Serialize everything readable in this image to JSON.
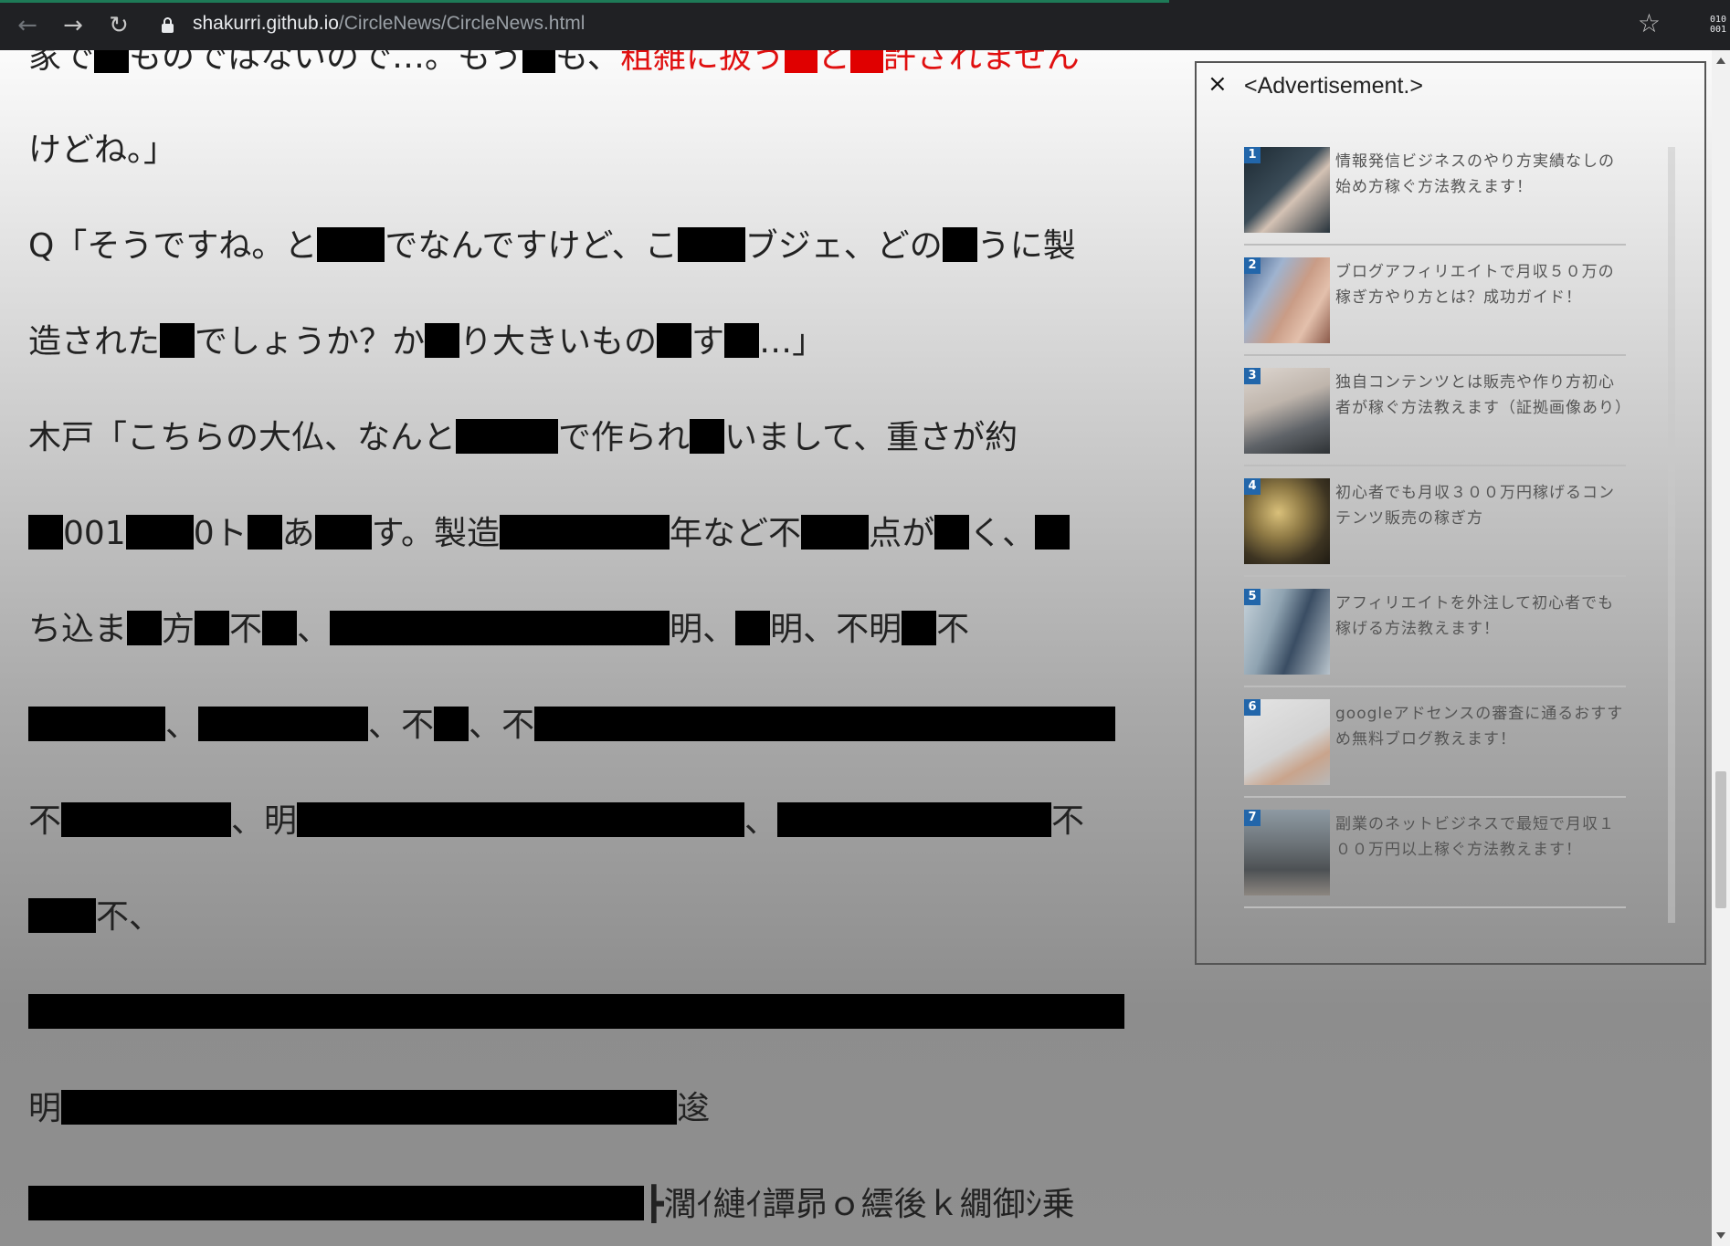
{
  "browser": {
    "url_host": "shakurri.github.io",
    "url_path": "/CircleNews/CircleNews.html",
    "ext_icon_text": "010\n001"
  },
  "article": {
    "line1_a": "家で",
    "line1_b": "ものではないので…。もう",
    "line1_c": "も、",
    "line1_red_a": "粗雑に扱う",
    "line1_red_b": "と",
    "line1_red_c": "許されません",
    "line2": "けどね。」",
    "line3_a": "Q「そうですね。と",
    "line3_b": "でなんですけど、こ",
    "line3_c": "ブジェ、どの",
    "line3_d": "うに製",
    "line4_a": "造された",
    "line4_b": "でしょうか？か",
    "line4_c": "り大きいもの",
    "line4_d": "す",
    "line4_e": "…」",
    "line5_a": "木戸「こちらの大仏、なんと",
    "line5_b": "で作られ",
    "line5_c": "いまして、重さが約",
    "line6_a": "001",
    "line6_b": "0ト",
    "line6_c": "あ",
    "line6_d": "す。製造",
    "line6_e": "年など不",
    "line6_f": "点が",
    "line6_g": "く、",
    "line7_a": "ち込ま",
    "line7_b": "方",
    "line7_c": "不",
    "line7_d": "、",
    "line7_e": "明、",
    "line7_f": "明、不明",
    "line7_g": "不",
    "line8_a": "、",
    "line8_b": "、不",
    "line8_c": "、不",
    "line9_a": "不",
    "line9_b": "、明",
    "line9_c": "、",
    "line9_d": "不",
    "line10_a": "不、",
    "line12_a": "明",
    "line12_b": "逡",
    "line13_a": "┣濶ｲ縺ｲ譚昴ｏ繧後ｋ繝御ｼ乗"
  },
  "ad": {
    "title": "<Advertisement.>",
    "close_label": "×",
    "items": [
      {
        "num": "1",
        "text": "情報発信ビジネスのやり方実績なしの始め方稼ぐ方法教えます！"
      },
      {
        "num": "2",
        "text": "ブログアフィリエイトで月収５０万の稼ぎ方やり方とは？成功ガイド！"
      },
      {
        "num": "3",
        "text": "独自コンテンツとは販売や作り方初心者が稼ぐ方法教えます（証拠画像あり）"
      },
      {
        "num": "4",
        "text": "初心者でも月収３００万円稼げるコンテンツ販売の稼ぎ方"
      },
      {
        "num": "5",
        "text": "アフィリエイトを外注して初心者でも稼げる方法教えます！"
      },
      {
        "num": "6",
        "text": "googleアドセンスの審査に通るおすすめ無料ブログ教えます！"
      },
      {
        "num": "7",
        "text": "副業のネットビジネスで最短で月収１００万円以上稼ぐ方法教えます！"
      }
    ]
  }
}
